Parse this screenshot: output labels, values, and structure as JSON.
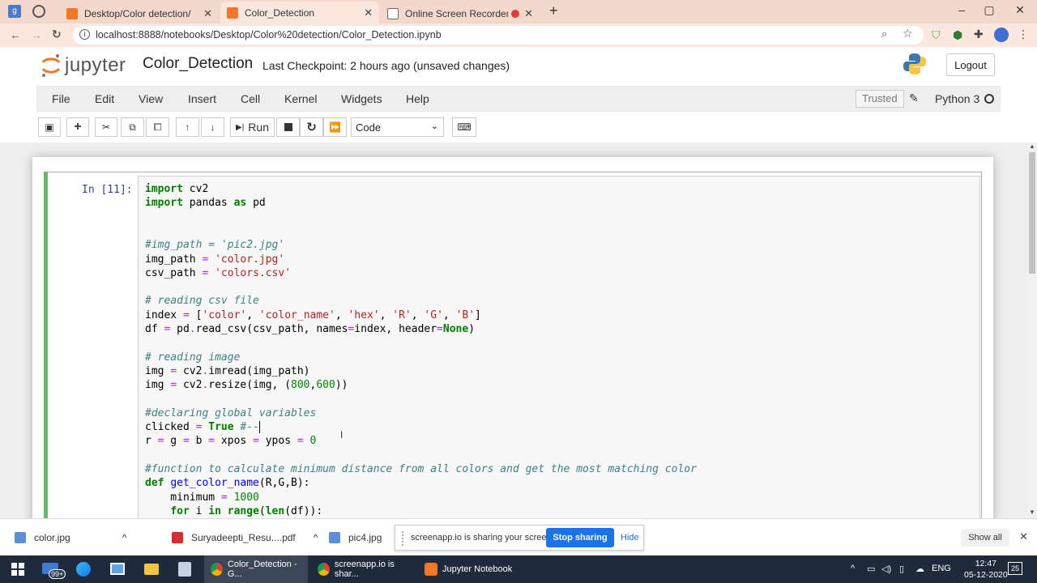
{
  "browser": {
    "tabs": [
      {
        "label": "Desktop/Color detection/",
        "active": false
      },
      {
        "label": "Color_Detection",
        "active": true
      },
      {
        "label": "Online Screen Recorder",
        "active": false
      }
    ],
    "url": "localhost:8888/notebooks/Desktop/Color%20detection/Color_Detection.ipynb"
  },
  "jupyter": {
    "logo_text": "jupyter",
    "notebook_title": "Color_Detection",
    "checkpoint": "Last Checkpoint: 2 hours ago",
    "unsaved": "(unsaved changes)",
    "logout_label": "Logout",
    "menu": [
      "File",
      "Edit",
      "View",
      "Insert",
      "Cell",
      "Kernel",
      "Widgets",
      "Help"
    ],
    "trusted_label": "Trusted",
    "kernel_name": "Python 3",
    "run_label": "Run",
    "cell_type": "Code"
  },
  "cell": {
    "prompt": "In [11]:",
    "lines": [
      "import cv2",
      "import pandas as pd",
      "",
      "",
      "#img_path = 'pic2.jpg'",
      "img_path = 'color.jpg'",
      "csv_path = 'colors.csv'",
      "",
      "# reading csv file",
      "index = ['color', 'color_name', 'hex', 'R', 'G', 'B']",
      "df = pd.read_csv(csv_path, names=index, header=None)",
      "",
      "# reading image",
      "img = cv2.imread(img_path)",
      "img = cv2.resize(img, (800,600))",
      "",
      "#declaring global variables",
      "clicked = True #--",
      "r = g = b = xpos = ypos = 0",
      "",
      "#function to calculate minimum distance from all colors and get the most matching color",
      "def get_color_name(R,G,B):",
      "    minimum = 1000",
      "    for i in range(len(df)):"
    ]
  },
  "downloads": [
    {
      "name": "color.jpg"
    },
    {
      "name": "Suryadeepti_Resu....pdf"
    },
    {
      "name": "pic4.jpg"
    }
  ],
  "share_bar": {
    "text": "screenapp.io is sharing your screen.",
    "stop_label": "Stop sharing",
    "hide_label": "Hide"
  },
  "show_all_label": "Show all",
  "taskbar": {
    "badge": "99+",
    "apps": [
      "Color_Detection - G...",
      "screenapp.io is shar...",
      "Jupyter Notebook"
    ],
    "lang": "ENG",
    "time": "12:47",
    "date": "05-12-2020",
    "notif_count": "25"
  },
  "colors": {
    "cell_border_edit": "#66bb6a",
    "prompt": "#303f9f",
    "stop_button": "#1a73e8"
  }
}
